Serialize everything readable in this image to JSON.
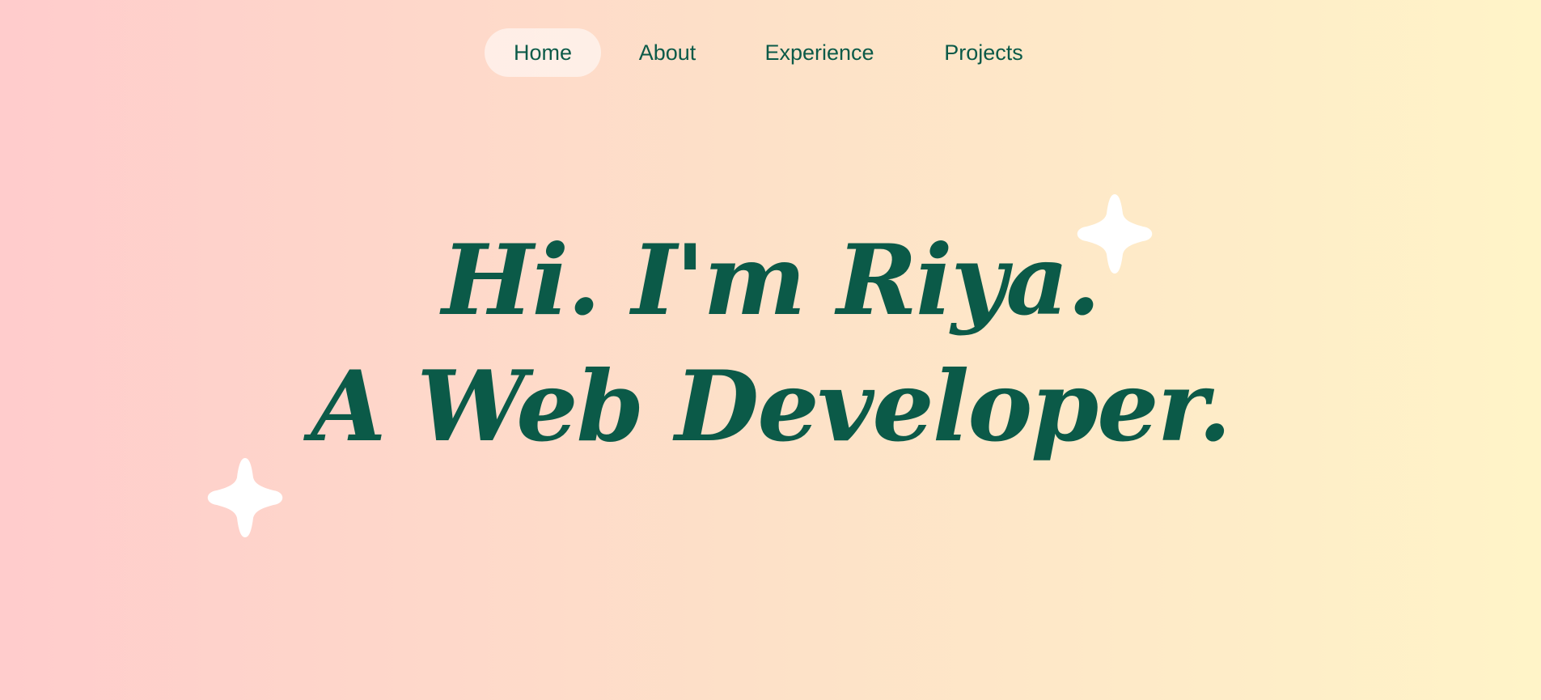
{
  "nav": {
    "items": [
      {
        "label": "Home",
        "active": true
      },
      {
        "label": "About",
        "active": false
      },
      {
        "label": "Experience",
        "active": false
      },
      {
        "label": "Projects",
        "active": false
      }
    ]
  },
  "hero": {
    "line1": "Hi. I'm Riya.",
    "line2": "A Web Developer."
  },
  "decor": {
    "sparkle_icon": "four-point-star",
    "sparkle_color": "#ffffff"
  },
  "colors": {
    "text": "#0b5a48",
    "background_left": "#ffcccc",
    "background_right": "#fff4c8",
    "active_pill": "#fde9e0"
  }
}
